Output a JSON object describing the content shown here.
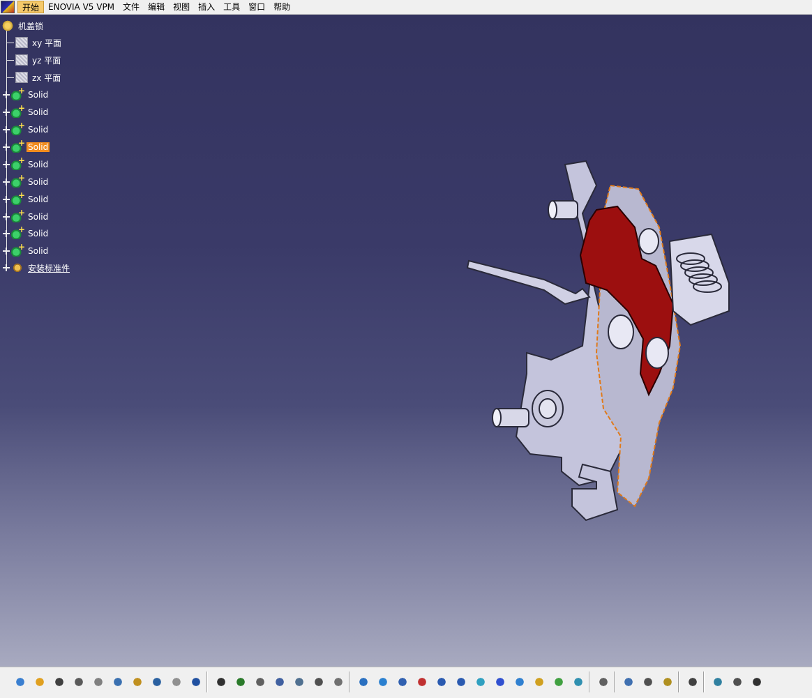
{
  "menubar": {
    "items": [
      {
        "label": "开始",
        "active": true
      },
      {
        "label": "ENOVIA V5 VPM"
      },
      {
        "label": "文件"
      },
      {
        "label": "编辑"
      },
      {
        "label": "视图"
      },
      {
        "label": "插入"
      },
      {
        "label": "工具"
      },
      {
        "label": "窗口"
      },
      {
        "label": "帮助"
      }
    ]
  },
  "tree": {
    "root": "机盖锁",
    "planes": [
      "xy 平面",
      "yz 平面",
      "zx 平面"
    ],
    "solids": [
      "Solid",
      "Solid",
      "Solid",
      "Solid",
      "Solid",
      "Solid",
      "Solid",
      "Solid",
      "Solid",
      "Solid"
    ],
    "selected_solid_index": 3,
    "standard_parts": "安装标准件"
  },
  "toolbar": {
    "icons": [
      "new-icon",
      "open-icon",
      "save-icon",
      "print-icon",
      "cut-icon",
      "copy-icon",
      "paste-icon",
      "undo-icon",
      "redo-icon",
      "whats-this-icon",
      "formula-icon",
      "comment-icon",
      "knowledge-icon",
      "table-icon",
      "graph-tree-icon",
      "lock-icon",
      "parameters-icon",
      "fly-mode-icon",
      "fit-all-icon",
      "pan-icon",
      "rotate-icon",
      "zoom-in-icon",
      "zoom-out-icon",
      "normal-view-icon",
      "multi-view-icon",
      "iso-view-icon",
      "shading-icon",
      "hide-show-icon",
      "swap-visible-icon",
      "catalog-icon",
      "measure-icon",
      "measure-item-icon",
      "mass-icon",
      "capture-icon",
      "refresh-icon",
      "hand-icon",
      "axis-icon"
    ]
  },
  "colors": {
    "background_top": "#33335f",
    "background_bottom": "#a8aac0",
    "selection": "#f28c1e",
    "model_red": "#9c0f0f",
    "model_metal": "#c4c4dc"
  }
}
